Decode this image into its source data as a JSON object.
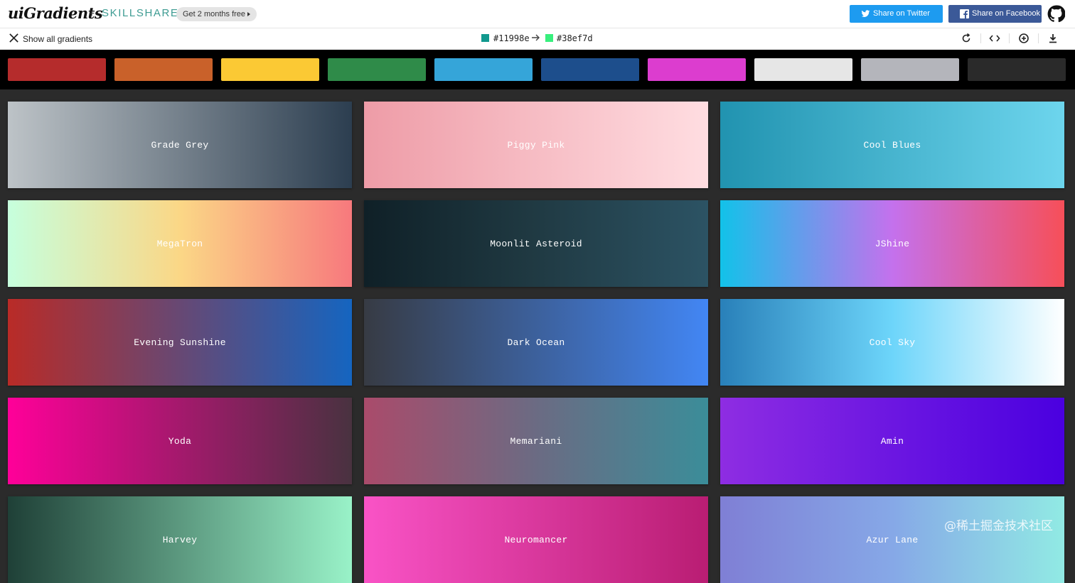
{
  "header": {
    "logo": "uiGradients",
    "plus": "+",
    "partner": "SKILLSHARE",
    "promo": "Get 2 months free",
    "share_twitter": "Share on Twitter",
    "share_facebook": "Share on Facebook"
  },
  "toolbar": {
    "show_all": "Show all gradients",
    "from_color": "#11998e",
    "to_color": "#38ef7d"
  },
  "filters": [
    "#b52c2c",
    "#c9612a",
    "#fbc934",
    "#2f8b49",
    "#35a5d9",
    "#1d4e8c",
    "#dc3dcf",
    "#e6e6e6",
    "#b4b5bb",
    "#2a2a2a"
  ],
  "gradients": [
    {
      "name": "Grade Grey",
      "from": "#bdc3c7",
      "to": "#2c3e50"
    },
    {
      "name": "Piggy Pink",
      "from": "#ee9ca7",
      "to": "#ffdde1"
    },
    {
      "name": "Cool Blues",
      "from": "#2193b0",
      "to": "#6dd5ed"
    },
    {
      "name": "MegaTron",
      "from": "#c6ffdd",
      "via": "#fbd786",
      "to": "#f7797d"
    },
    {
      "name": "Moonlit Asteroid",
      "from": "#0f2027",
      "via": "#203a43",
      "to": "#2c5364"
    },
    {
      "name": "JShine",
      "from": "#12c2e9",
      "via": "#c471ed",
      "to": "#f64f59"
    },
    {
      "name": "Evening Sunshine",
      "from": "#b92b27",
      "to": "#1565c0"
    },
    {
      "name": "Dark Ocean",
      "from": "#373b44",
      "to": "#4286f4"
    },
    {
      "name": "Cool Sky",
      "from": "#2980b9",
      "via": "#6dd5fa",
      "to": "#ffffff"
    },
    {
      "name": "Yoda",
      "from": "#ff0099",
      "to": "#493240"
    },
    {
      "name": "Memariani",
      "from": "#aa4b6b",
      "via": "#6b6b83",
      "to": "#3b8d99"
    },
    {
      "name": "Amin",
      "from": "#8e2de2",
      "to": "#4a00e0"
    },
    {
      "name": "Harvey",
      "from": "#1f4037",
      "to": "#99f2c8"
    },
    {
      "name": "Neuromancer",
      "from": "#f953c6",
      "to": "#b91d73"
    },
    {
      "name": "Azur Lane",
      "from": "#7f7fd5",
      "via": "#86a8e7",
      "to": "#91eae4"
    }
  ],
  "watermark": "@稀土掘金技术社区"
}
